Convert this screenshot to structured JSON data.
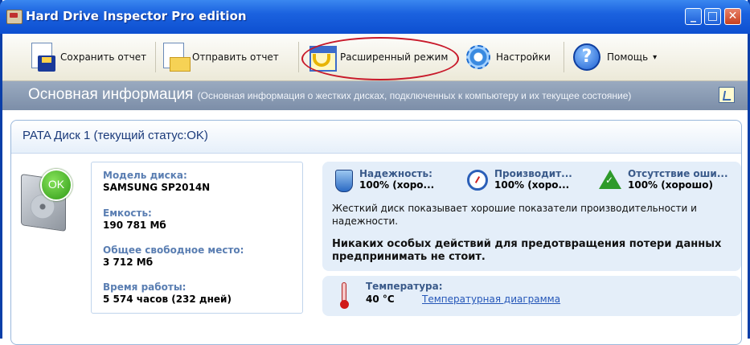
{
  "window": {
    "title": "Hard Drive Inspector Pro edition",
    "controls": {
      "minimize": "_",
      "maximize": "□",
      "close": "✕"
    }
  },
  "toolbar": {
    "save_label": "Сохранить отчет",
    "send_label": "Отправить отчет",
    "advanced_label": "Расширенный режим",
    "settings_label": "Настройки",
    "help_label": "Помощь",
    "help_dropdown_glyph": "▾"
  },
  "section": {
    "title": "Основная информация",
    "description": "(Основная информация о жестких дисках, подключенных к компьютеру и их текущее состояние)"
  },
  "disk": {
    "header": "PATA Диск 1 (текущий статус:OK)",
    "badge": "OK",
    "model_label": "Модель диска:",
    "model_value": "SAMSUNG SP2014N",
    "capacity_label": "Емкость:",
    "capacity_value": "190 781 Мб",
    "free_label": "Общее свободное место:",
    "free_value": "3 712 Мб",
    "uptime_label": "Время работы:",
    "uptime_value": "5 574 часов (232 дней)"
  },
  "status": {
    "reliability_label": "Надежность:",
    "reliability_value": "100% (хоро...",
    "performance_label": "Производит...",
    "performance_value": "100% (хоро...",
    "errors_label": "Отсутствие оши...",
    "errors_value": "100% (хорошо)",
    "summary": "Жесткий диск показывает хорошие показатели производительности и надежности.",
    "advice": "Никаких особых действий для предотвращения потери данных предпринимать не стоит."
  },
  "temperature": {
    "label": "Температура:",
    "value": "40 °C",
    "link": "Температурная диаграмма"
  },
  "colors": {
    "titlebar": "#1b62df",
    "section_bar": "#8a9ab2",
    "highlight": "#c8192a",
    "ok_green": "#2f9a16",
    "link": "#2456b8"
  }
}
